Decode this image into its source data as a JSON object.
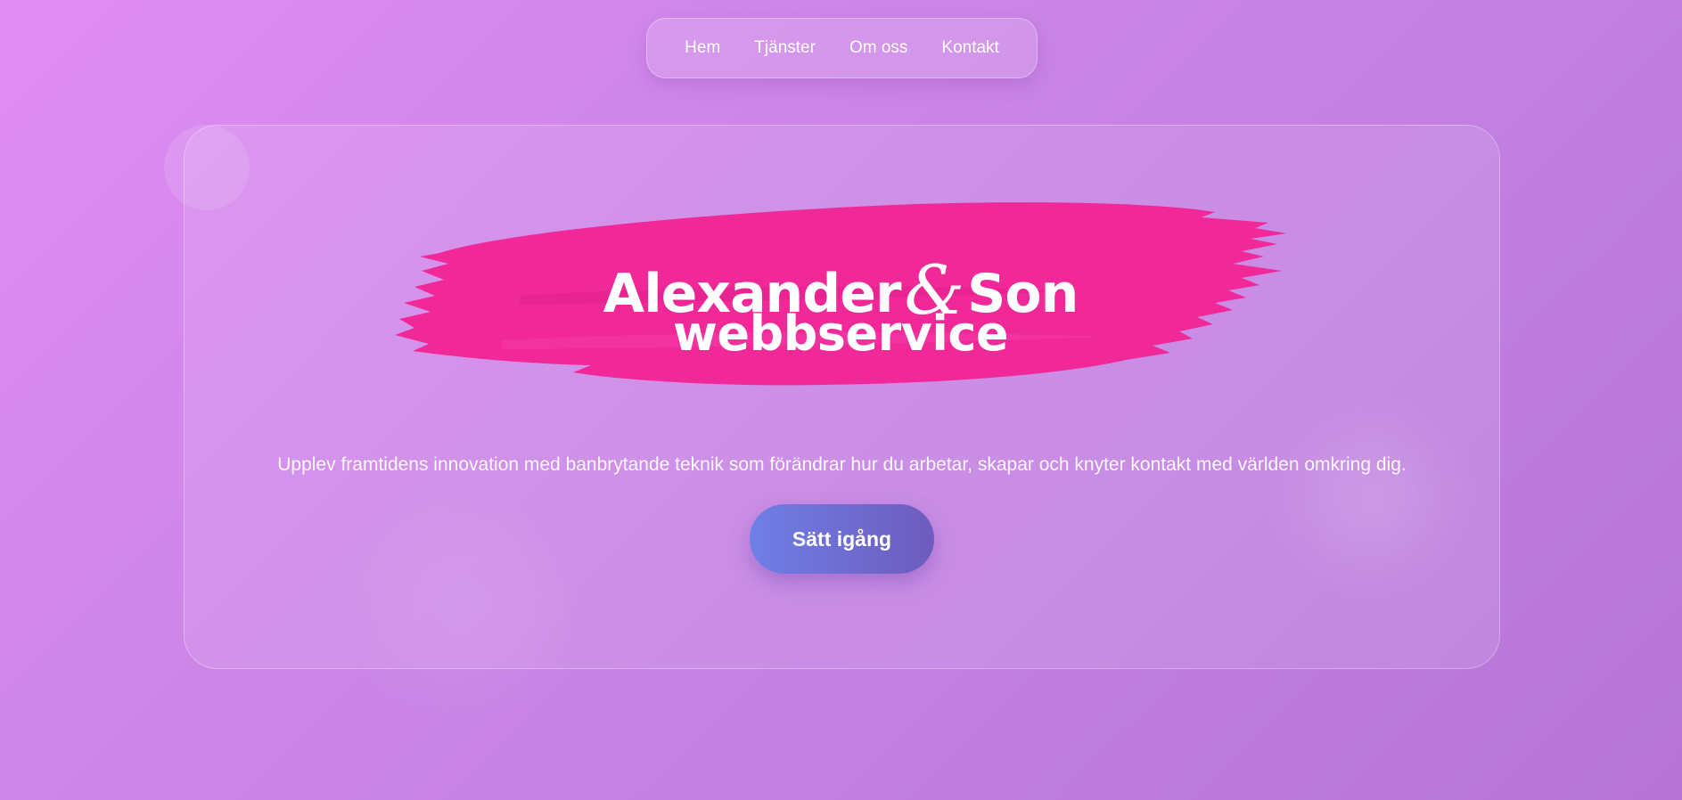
{
  "nav": {
    "items": [
      {
        "label": "Hem"
      },
      {
        "label": "Tjänster"
      },
      {
        "label": "Om oss"
      },
      {
        "label": "Kontakt"
      }
    ]
  },
  "hero": {
    "logo": {
      "name_part1": "Alexander",
      "ampersand": "&",
      "name_part2": "Son",
      "subtitle": "webbservice"
    },
    "tagline": "Upplev framtidens innovation med banbrytande teknik som förändrar hur du arbetar, skapar och knyter kontakt med världen omkring dig.",
    "cta_label": "Sätt igång"
  },
  "colors": {
    "background_start": "#e08cf5",
    "background_end": "#b574d6",
    "brush": "#f02898",
    "cta_start": "#6f7fe6",
    "cta_end": "#6e5bbd",
    "text": "#ffffff"
  }
}
